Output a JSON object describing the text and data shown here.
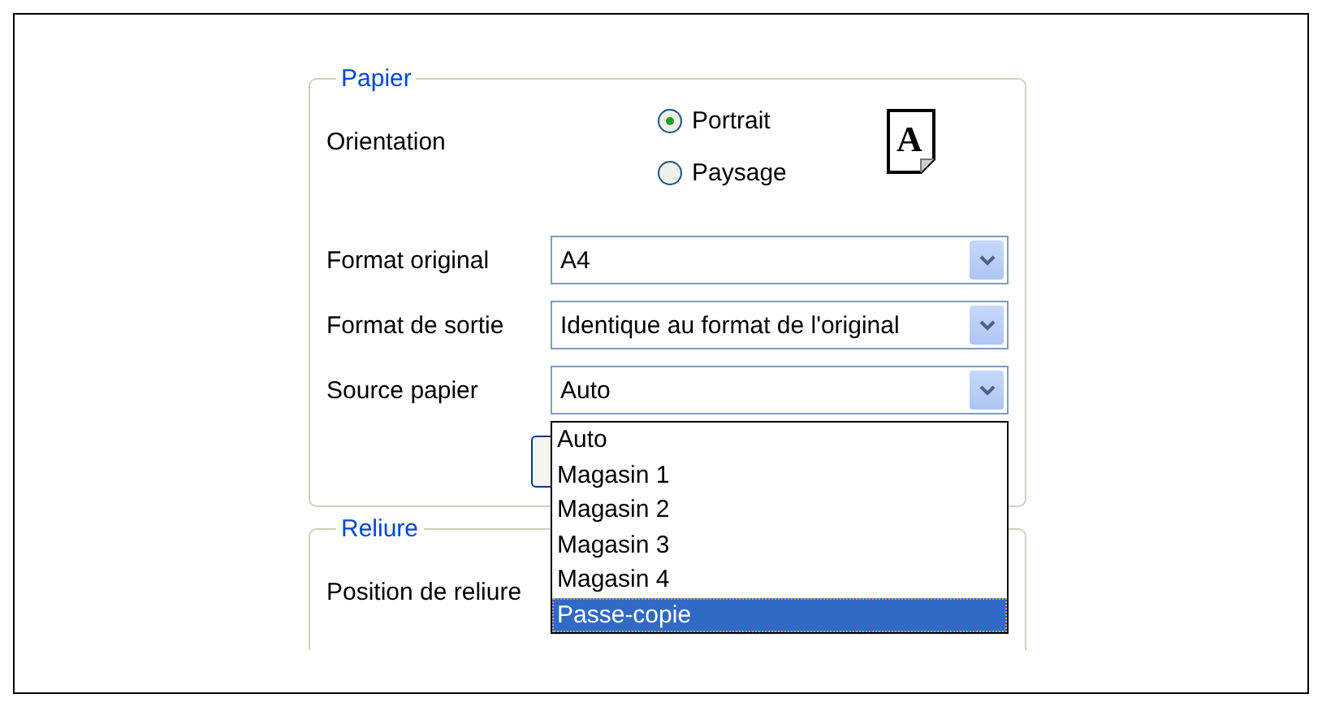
{
  "paper_group": {
    "title": "Papier",
    "orientation": {
      "label": "Orientation",
      "options": [
        {
          "label": "Portrait",
          "selected": true
        },
        {
          "label": "Paysage",
          "selected": false
        }
      ],
      "icon_letter": "A"
    },
    "fields": [
      {
        "label": "Format original",
        "value": "A4"
      },
      {
        "label": "Format de sortie",
        "value": "Identique au format de l'original"
      },
      {
        "label": "Source papier",
        "value": "Auto"
      }
    ],
    "open_dropdown": {
      "items": [
        {
          "label": "Auto",
          "selected": false
        },
        {
          "label": "Magasin 1",
          "selected": false
        },
        {
          "label": "Magasin 2",
          "selected": false
        },
        {
          "label": "Magasin 3",
          "selected": false
        },
        {
          "label": "Magasin 4",
          "selected": false
        },
        {
          "label": "Passe-copie",
          "selected": true
        }
      ]
    }
  },
  "binding_group": {
    "title": "Reliure",
    "field_label": "Position de reliure"
  }
}
